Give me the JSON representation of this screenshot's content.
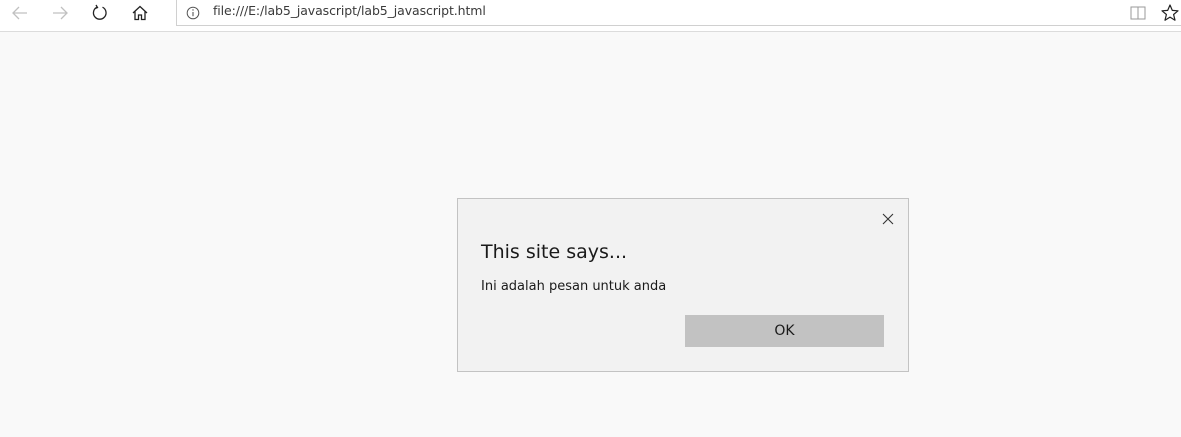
{
  "browser": {
    "url": "file:///E:/lab5_javascript/lab5_javascript.html",
    "icons": {
      "back": "back-arrow-icon",
      "forward": "forward-arrow-icon",
      "refresh": "refresh-icon",
      "home": "home-icon",
      "site_info": "info-icon",
      "reading_view": "reading-view-icon",
      "favorites": "star-icon"
    }
  },
  "dialog": {
    "title": "This site says...",
    "message": "Ini adalah pesan untuk anda",
    "ok_label": "OK",
    "close_icon": "close-icon"
  },
  "colors": {
    "page_background": "#f9f9f9",
    "dialog_background": "#f2f2f2",
    "ok_button": "#c2c2c2"
  }
}
